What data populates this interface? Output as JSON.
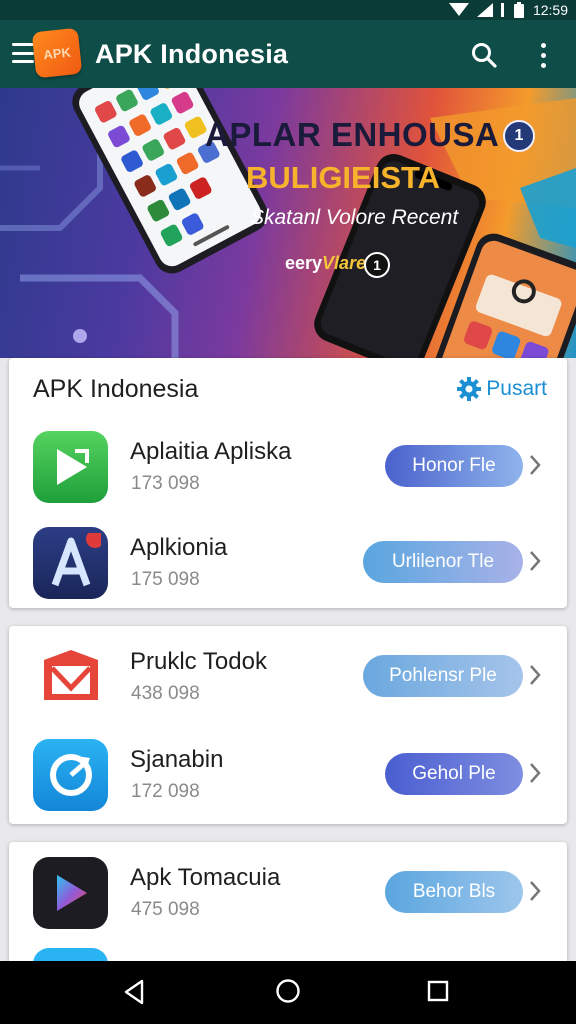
{
  "status_bar": {
    "time": "12:59"
  },
  "app_bar": {
    "logo_text": "APK",
    "title": "APK Indonesia"
  },
  "banner": {
    "title": "APLAR ENHOUSA",
    "subtitle": "BULIGIEISTA",
    "line3": "Skatanl Volore Recent",
    "line4_a": "eery",
    "line4_b": "Vlare",
    "badge": "1",
    "info": "1"
  },
  "section": {
    "title": "APK Indonesia",
    "refresh_label": "Pusart"
  },
  "apps": [
    {
      "name": "Aplaitia Apliska",
      "meta": "173 098",
      "button": "Honor Fle",
      "icon": "play-arrow-icon"
    },
    {
      "name": "Aplkionia",
      "meta": "175 098",
      "button": "Urlilenor Tle",
      "icon": "letter-a-icon"
    },
    {
      "name": "Pruklc Todok",
      "meta": "438 098",
      "button": "Pohlensr Ple",
      "icon": "gmail-envelope-icon"
    },
    {
      "name": "Sjanabin",
      "meta": "172 098",
      "button": "Gehol Ple",
      "icon": "sync-circle-icon"
    },
    {
      "name": "Apk Tomacuia",
      "meta": "475 098",
      "button": "Behor Bls",
      "icon": "play-store-icon"
    }
  ],
  "colors": {
    "app_bar": "#0f4e48",
    "accent_link": "#1c8fd4",
    "button_blue": "#4a6fd1",
    "button_light": "#7aaee0"
  }
}
